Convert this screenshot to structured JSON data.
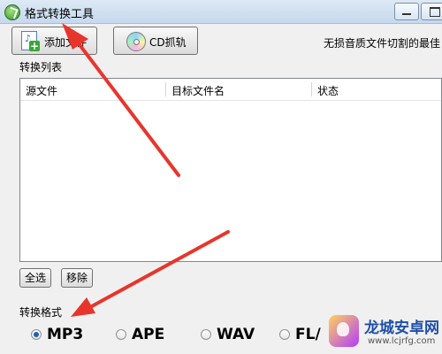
{
  "window": {
    "title": "格式转换工具",
    "icon": "app-logo-icon",
    "minimize_icon": "minimize-icon",
    "maximize_icon": "maximize-icon"
  },
  "toolbar": {
    "add_file_label": "添加文件",
    "add_file_icon": "add-audio-file-icon",
    "cd_rip_label": "CD抓轨",
    "cd_rip_icon": "cd-hand-icon",
    "slogan": "无损音质文件切割的最佳"
  },
  "file_list": {
    "group_label": "转换列表",
    "columns": [
      "源文件",
      "目标文件名",
      "状态"
    ],
    "rows": []
  },
  "list_actions": {
    "select_all_label": "全选",
    "remove_label": "移除"
  },
  "format": {
    "group_label": "转换格式",
    "options": [
      {
        "label": "MP3",
        "selected": true
      },
      {
        "label": "APE",
        "selected": false
      },
      {
        "label": "WAV",
        "selected": false
      },
      {
        "label": "FL/",
        "selected": false
      }
    ]
  },
  "annotations": {
    "arrow_color": "#e8352c"
  },
  "watermark": {
    "name": "龙城安卓网",
    "url": "www.lcjrfg.com"
  }
}
